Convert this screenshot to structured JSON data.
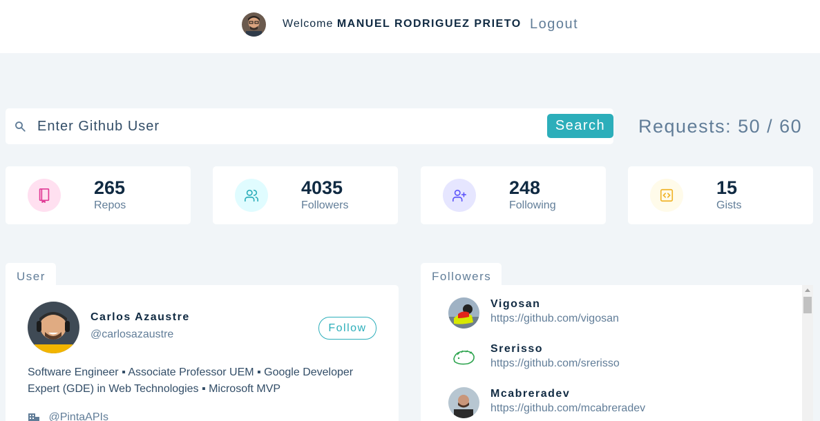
{
  "header": {
    "welcome_prefix": "Welcome",
    "user_name": "MANUEL RODRIGUEZ PRIETO",
    "logout": "Logout"
  },
  "search": {
    "placeholder": "Enter Github User",
    "button": "Search",
    "requests": "Requests: 50 / 60"
  },
  "stats": [
    {
      "value": "265",
      "label": "Repos",
      "icon": "repo-book-icon",
      "color": "#e03a95"
    },
    {
      "value": "4035",
      "label": "Followers",
      "icon": "users-icon",
      "color": "#2caeba"
    },
    {
      "value": "248",
      "label": "Following",
      "icon": "user-plus-icon",
      "color": "#5d55fa"
    },
    {
      "value": "15",
      "label": "Gists",
      "icon": "code-icon",
      "color": "#f0b429"
    }
  ],
  "user_panel": {
    "tab": "User",
    "name": "Carlos Azaustre",
    "handle": "@carlosazaustre",
    "follow": "Follow",
    "bio": "Software Engineer ▪ Associate Professor UEM ▪ Google Developer Expert (GDE) in Web Technologies ▪ Microsoft MVP",
    "company": "@PintaAPIs"
  },
  "followers_panel": {
    "tab": "Followers",
    "items": [
      {
        "name": "Vigosan",
        "url": "https://github.com/vigosan"
      },
      {
        "name": "Srerisso",
        "url": "https://github.com/srerisso"
      },
      {
        "name": "Mcabreradev",
        "url": "https://github.com/mcabreradev"
      }
    ]
  },
  "colors": {
    "accent": "#2caeba",
    "background": "#f1f5f8",
    "text_dark": "#102a42",
    "text_muted": "#617d98"
  }
}
